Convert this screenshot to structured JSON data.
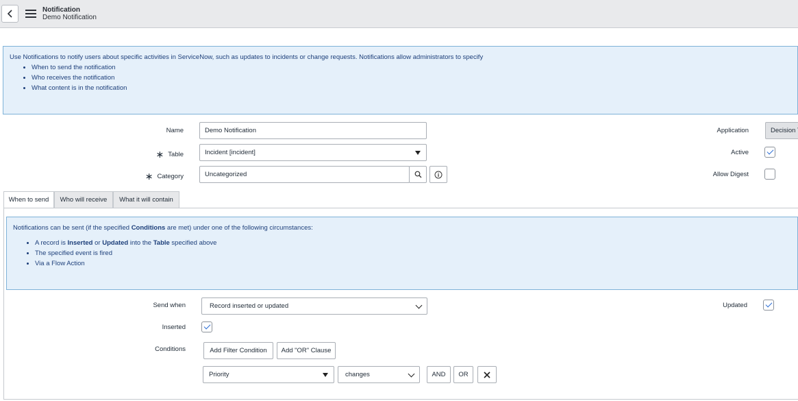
{
  "header": {
    "title": "Notification",
    "subtitle": "Demo Notification"
  },
  "intro": {
    "text": "Use Notifications to notify users about specific activities in ServiceNow, such as updates to incidents or change requests. Notifications allow administrators to specify",
    "items": [
      "When to send the notification",
      "Who receives the notification",
      "What content is in the notification"
    ]
  },
  "form": {
    "name_label": "Name",
    "name_value": "Demo Notification",
    "table_label": "Table",
    "table_value": "Incident [incident]",
    "category_label": "Category",
    "category_value": "Uncategorized",
    "application_label": "Application",
    "application_value": "Decision T",
    "active_label": "Active",
    "active_checked": true,
    "allow_digest_label": "Allow Digest",
    "allow_digest_checked": false,
    "required_mark": "∗"
  },
  "tabs": [
    {
      "label": "When to send",
      "active": true
    },
    {
      "label": "Who will receive",
      "active": false
    },
    {
      "label": "What it will contain",
      "active": false
    }
  ],
  "when_info": {
    "intro_pre": "Notifications can be sent (if the specified ",
    "intro_bold": "Conditions",
    "intro_post": " are met) under one of the following circumstances:",
    "item1_a": "A record is ",
    "item1_b": "Inserted",
    "item1_c": " or ",
    "item1_d": "Updated",
    "item1_e": " into the ",
    "item1_f": "Table",
    "item1_g": " specified above",
    "item2": "The specified event is fired",
    "item3": "Via a Flow Action"
  },
  "when": {
    "send_when_label": "Send when",
    "send_when_value": "Record inserted or updated",
    "updated_label": "Updated",
    "updated_checked": true,
    "inserted_label": "Inserted",
    "inserted_checked": true,
    "conditions_label": "Conditions",
    "add_filter_label": "Add Filter Condition",
    "add_or_label": "Add \"OR\" Clause",
    "condition_field": "Priority",
    "condition_operator": "changes",
    "and_label": "AND",
    "or_label": "OR"
  }
}
